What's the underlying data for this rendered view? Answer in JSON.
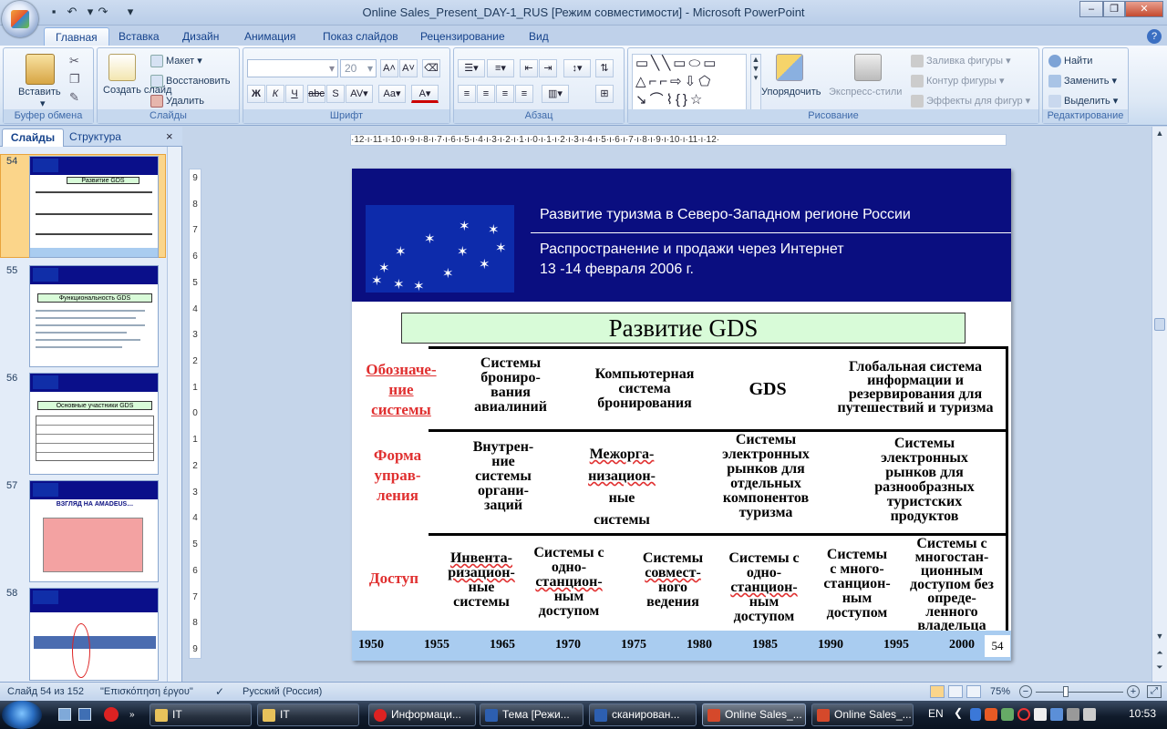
{
  "window": {
    "title": "Online Sales_Present_DAY-1_RUS [Режим совместимости] - Microsoft PowerPoint"
  },
  "tabs": [
    "Главная",
    "Вставка",
    "Дизайн",
    "Анимация",
    "Показ слайдов",
    "Рецензирование",
    "Вид"
  ],
  "ribbon": {
    "clipboard": {
      "label": "Буфер обмена",
      "paste": "Вставить"
    },
    "slides": {
      "label": "Слайды",
      "new_slide": "Создать слайд",
      "layout": "Макет",
      "reset": "Восстановить",
      "delete": "Удалить"
    },
    "font": {
      "label": "Шрифт",
      "size": "20"
    },
    "paragraph": {
      "label": "Абзац"
    },
    "drawing": {
      "label": "Рисование",
      "arrange": "Упорядочить",
      "quick_styles": "Экспресс-стили",
      "fill": "Заливка фигуры",
      "outline": "Контур фигуры",
      "effects": "Эффекты для фигур"
    },
    "editing": {
      "label": "Редактирование",
      "find": "Найти",
      "replace": "Заменить",
      "select": "Выделить"
    }
  },
  "left_pane": {
    "tab_slides": "Слайды",
    "tab_outline": "Структура",
    "thumbnails": [
      {
        "number": "54",
        "title": "Развитие GDS"
      },
      {
        "number": "55",
        "title": "Функциональность GDS"
      },
      {
        "number": "56",
        "title": "Основные участники GDS"
      },
      {
        "number": "57",
        "title": "ВЗГЛЯД НА AMADEUS…"
      },
      {
        "number": "58",
        "title": ""
      }
    ]
  },
  "ruler_h": "·12·ı·11·ı·10·ı·9·ı·8·ı·7·ı·6·ı·5·ı·4·ı·3·ı·2·ı·1·ı·0·ı·1·ı·2·ı·3·ı·4·ı·5·ı·6·ı·7·ı·8·ı·9·ı·10·ı·11·ı·12·",
  "ruler_v": [
    "9",
    "8",
    "7",
    "6",
    "5",
    "4",
    "3",
    "2",
    "1",
    "0",
    "1",
    "2",
    "3",
    "4",
    "5",
    "6",
    "7",
    "8",
    "9"
  ],
  "slide": {
    "header_line1": "Развитие туризма в Северо-Западном регионе России",
    "header_line2": "Распространение и продажи через Интернет",
    "header_line3": "13 -14 февраля 2006 г.",
    "title": "Развитие GDS",
    "row_labels": {
      "designation_part1": "Обозначе-",
      "designation_part2": "ние системы",
      "management_1": "Форма",
      "management_2": "управ-",
      "management_3": "ления",
      "access": "Доступ"
    },
    "row1": {
      "c1": [
        "Системы",
        "брониро-",
        "вания",
        "авиалиний"
      ],
      "c2": [
        "Компьютерная",
        "система",
        "бронирования"
      ],
      "c3": "GDS",
      "c4": [
        "Глобальная система",
        "информации и",
        "резервирования для",
        "путешествий и туризма"
      ]
    },
    "row2": {
      "c1": [
        "Внутрен-",
        "ние",
        "системы",
        "органи-",
        "заций"
      ],
      "c2": [
        "Межорга-",
        "низацион-",
        "ные",
        "системы"
      ],
      "c3": [
        "Системы",
        "электронных",
        "рынков для",
        "отдельных",
        "компонентов",
        "туризма"
      ],
      "c4": [
        "Системы",
        "электронных",
        "рынков для",
        "разнообразных",
        "туристских",
        "продуктов"
      ]
    },
    "row3": {
      "c1": [
        "Инвента-",
        "ризацион-",
        "ные",
        "системы"
      ],
      "c2": [
        "Системы с",
        "одно-",
        "станцион-",
        "ным",
        "доступом"
      ],
      "c3": [
        "Системы",
        "совмест-",
        "ного",
        "ведения"
      ],
      "c4": [
        "Системы с",
        "одно-",
        "станцион-",
        "ным",
        "доступом"
      ],
      "c5": [
        "Системы",
        "с много-",
        "станцион-",
        "ным",
        "доступом"
      ],
      "c6": [
        "Системы с",
        "многостан-",
        "ционным",
        "доступом без",
        "опреде-",
        "ленного",
        "владельца"
      ]
    },
    "years": [
      "1950",
      "1955",
      "1965",
      "1970",
      "1975",
      "1980",
      "1985",
      "1990",
      "1995",
      "2000"
    ],
    "slide_number": "54"
  },
  "status": {
    "slide_info": "Слайд 54 из 152",
    "theme": "\"Επισκόπηση έργου\"",
    "language": "Русский (Россия)",
    "zoom": "75%"
  },
  "taskbar": {
    "items": [
      "IT",
      "IT",
      "Информаци...",
      "Тема [Режи...",
      "сканирован...",
      "Online Sales_...",
      "Online Sales_..."
    ],
    "lang": "EN",
    "clock": "10:53"
  },
  "colors": {
    "slide_header": "#0a0e80",
    "title_box": "#d8fbd8",
    "row_label": "#e03030",
    "years_bar": "#a9ccf0"
  }
}
